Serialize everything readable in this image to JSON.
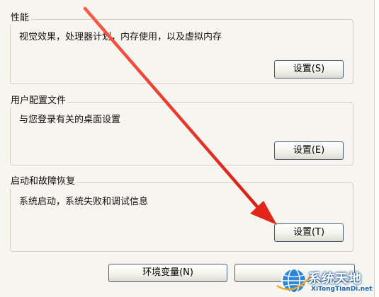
{
  "performance": {
    "title": "性能",
    "description": "视觉效果，处理器计划，内存使用，以及虚拟内存",
    "settings_button": "设置(S)"
  },
  "user_profiles": {
    "title": "用户配置文件",
    "description": "与您登录有关的桌面设置",
    "settings_button": "设置(E)"
  },
  "startup_recovery": {
    "title": "启动和故障恢复",
    "description": "系统启动，系统失败和调试信息",
    "settings_button": "设置(T)"
  },
  "footer": {
    "env_variables_button": "环境变量(N)"
  },
  "watermark": {
    "name": "系统天地",
    "url": "XiTongTianDi.net"
  },
  "colors": {
    "annotation_arrow": "#e1251b",
    "dialog_background": "#f6f5ef",
    "button_border": "#4a5a7a"
  },
  "icons": {
    "annotation": "red-arrow-icon",
    "watermark": "globe-logo-icon"
  }
}
